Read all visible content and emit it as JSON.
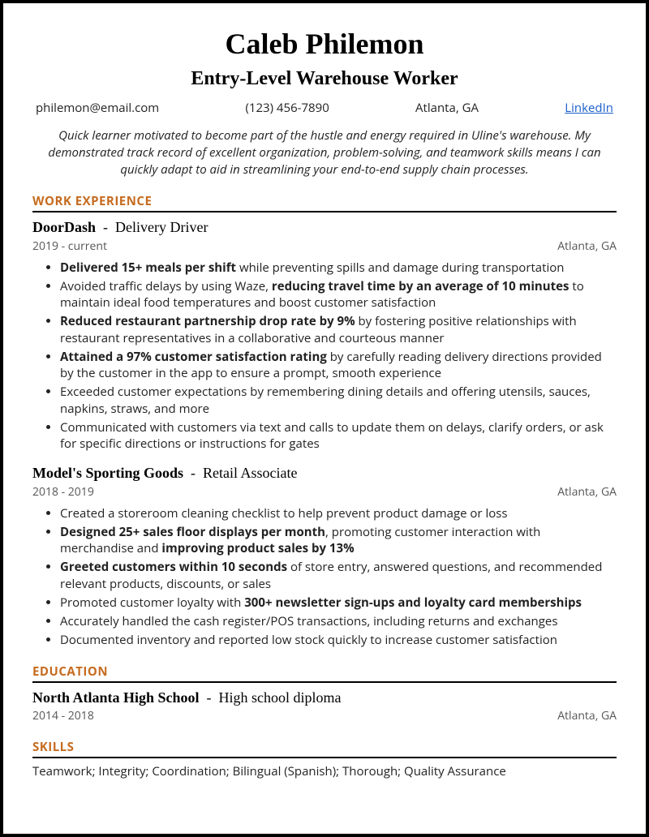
{
  "name": "Caleb Philemon",
  "title": "Entry-Level Warehouse Worker",
  "contact": {
    "email": "philemon@email.com",
    "phone": "(123) 456-7890",
    "location": "Atlanta, GA",
    "linkedin": "LinkedIn"
  },
  "summary": "Quick learner motivated to become part of the hustle and energy required in Uline's warehouse. My demonstrated track record of excellent organization, problem-solving, and teamwork skills means I can quickly adapt to aid in streamlining your end-to-end supply chain processes.",
  "sections": {
    "work": "WORK EXPERIENCE",
    "education": "EDUCATION",
    "skills": "SKILLS"
  },
  "jobs": [
    {
      "company": "DoorDash",
      "role": "Delivery Driver",
      "dates": "2019 - current",
      "location": "Atlanta, GA",
      "bullets": [
        {
          "b1": "Delivered 15+ meals per shift",
          "t1": " while preventing spills and damage during transportation"
        },
        {
          "t0": "Avoided traffic delays by using Waze, ",
          "b1": "reducing travel time by an average of 10 minutes",
          "t1": " to maintain ideal food temperatures and boost customer satisfaction"
        },
        {
          "b1": "Reduced restaurant partnership drop rate by 9%",
          "t1": " by fostering positive relationships with restaurant representatives in a collaborative and courteous manner"
        },
        {
          "b1": "Attained a 97% customer satisfaction rating",
          "t1": " by carefully reading delivery directions provided by the customer in the app to ensure a prompt, smooth experience"
        },
        {
          "t0": "Exceeded customer expectations by remembering dining details and offering utensils, sauces, napkins, straws, and more"
        },
        {
          "t0": "Communicated with customers via text and calls to update them on delays, clarify orders, or ask for specific directions or instructions for gates"
        }
      ]
    },
    {
      "company": "Model's Sporting Goods",
      "role": "Retail Associate",
      "dates": "2018 - 2019",
      "location": "Atlanta, GA",
      "bullets": [
        {
          "t0": "Created a storeroom cleaning checklist to help prevent product damage or loss"
        },
        {
          "b1": "Designed 25+ sales floor displays per month",
          "t1": ", promoting customer interaction with merchandise and ",
          "b2": "improving product sales by 13%"
        },
        {
          "b1": "Greeted customers within 10 seconds",
          "t1": " of store entry, answered questions, and recommended relevant products, discounts, or sales"
        },
        {
          "t0": "Promoted customer loyalty with ",
          "b1": "300+ newsletter sign-ups and loyalty card memberships"
        },
        {
          "t0": "Accurately handled the cash register/POS transactions, including returns and exchanges"
        },
        {
          "t0": "Documented inventory and reported low stock quickly to increase customer satisfaction"
        }
      ]
    }
  ],
  "education": {
    "school": "North Atlanta High School",
    "degree": "High school diploma",
    "dates": "2014 - 2018",
    "location": "Atlanta, GA"
  },
  "skills": "Teamwork; Integrity; Coordination; Bilingual (Spanish); Thorough; Quality Assurance"
}
